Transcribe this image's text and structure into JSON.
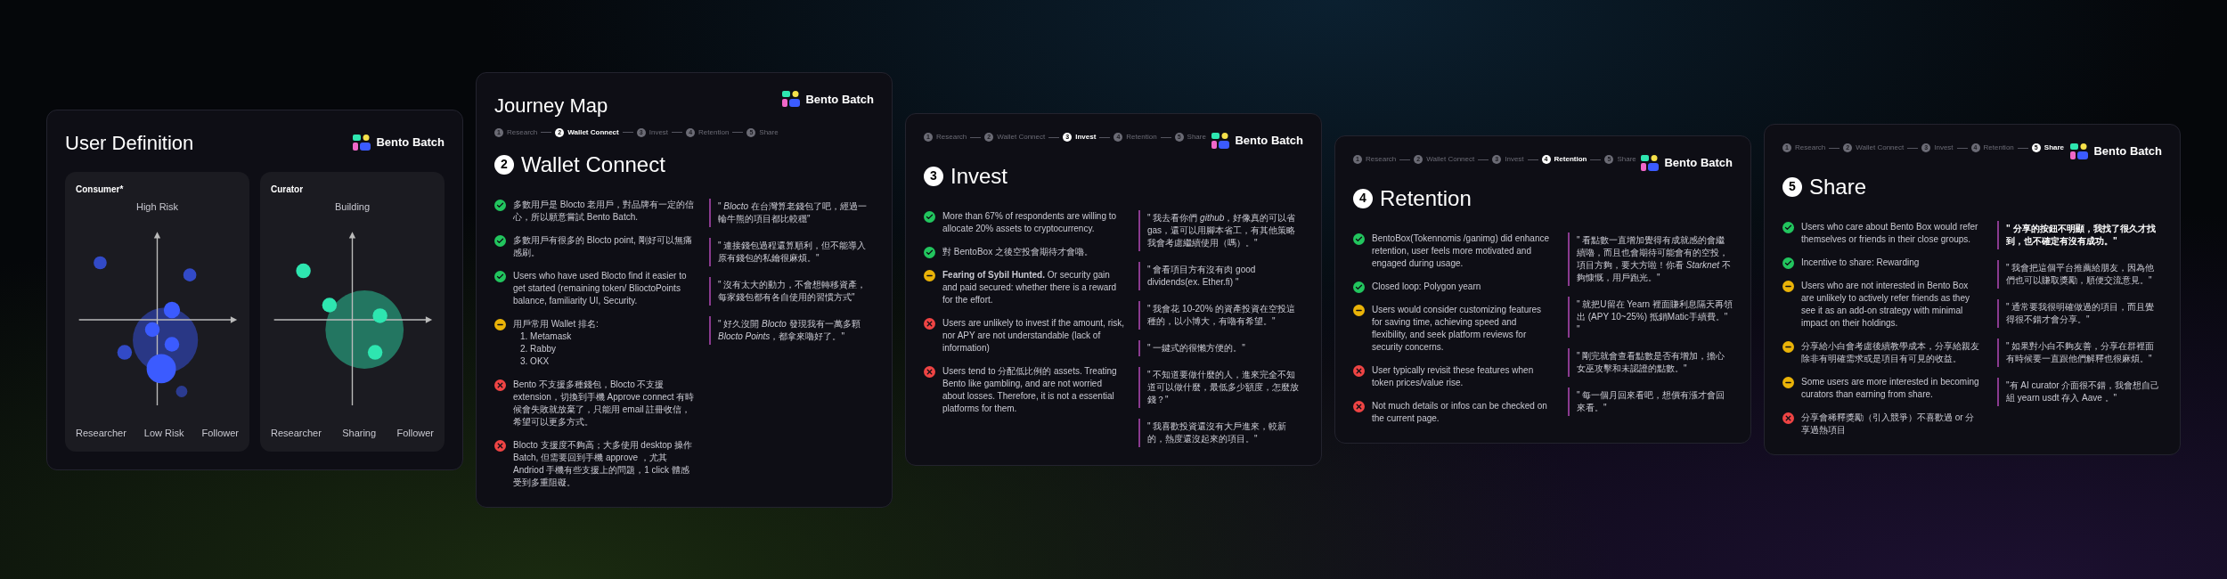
{
  "slides": [
    {
      "kind": "definition",
      "title": "User Definition",
      "logo": "Bento Batch",
      "maps": [
        {
          "label": "Consumer*",
          "color": "#3b5bff",
          "top": "High Risk",
          "bottom": "Low Risk",
          "left": "Researcher",
          "right": "Follower"
        },
        {
          "label": "Curator",
          "color": "#2ee6b0",
          "top": "Building",
          "bottom": "Sharing",
          "left": "Researcher",
          "right": "Follower"
        }
      ]
    },
    {
      "kind": "journey",
      "title": "Journey Map",
      "logo": "Bento Batch",
      "steps": [
        {
          "number": "1",
          "label": "Research",
          "selected": false
        },
        {
          "number": "2",
          "label": "Wallet Connect",
          "selected": true
        },
        {
          "number": "3",
          "label": "Invest",
          "selected": false
        },
        {
          "number": "4",
          "label": "Retention",
          "selected": false
        },
        {
          "number": "5",
          "label": "Share",
          "selected": false
        }
      ],
      "stage_number": "2",
      "stage": "Wallet Connect",
      "findings": [
        {
          "kind": "positive",
          "text": "多數用戶是 Blocto 老用戶，對品牌有一定的信心，所以願意嘗試 Bento Batch."
        },
        {
          "kind": "positive",
          "text": "多數用戶有很多的 Blocto point, 剛好可以無痛感刷。"
        },
        {
          "kind": "positive",
          "text": "Users who have used Blocto find it easier to get started (remaining token/ BlioctoPoints balance, familiarity UI, Security."
        },
        {
          "kind": "neutral",
          "text": "用戶常用 Wallet 排名:",
          "list": [
            "1. Metamask",
            "2. Rabby",
            "3. OKX"
          ]
        },
        {
          "kind": "negative",
          "text": "Bento 不支援多種錢包，Blocto 不支援 extension，切換到手機 Approve connect 有時候會失敗就放棄了，只能用 email 註冊收信，希望可以更多方式。"
        },
        {
          "kind": "negative",
          "text": "Blocto 支援度不夠高；大多使用 desktop 操作 Batch, 但需要回到手機 approve ，尤其 Andriod 手機有些支援上的問題，1 click 體感受到多重阻礙。"
        }
      ],
      "quotes": [
        {
          "text": "\" *Blocto* 在台灣算老錢包了吧，經過一輪牛熊的項目都比較穩\"",
          "emphasis": false
        },
        {
          "text": "\" 連接錢包過程還算順利，但不能導入原有錢包的私鑰很麻煩。\"",
          "emphasis": false
        },
        {
          "text": "\" 沒有太大的動力，不會想轉移資產，每家錢包都有各自使用的習慣方式\"",
          "emphasis": false
        },
        {
          "text": "\" 好久沒開 *Blocto* 發現我有一萬多顆 *Blocto Points*，都拿來嚕好了。\"",
          "emphasis": false
        }
      ]
    },
    {
      "kind": "journey",
      "logo": "Bento Batch",
      "steps": [
        {
          "number": "1",
          "label": "Research",
          "selected": false
        },
        {
          "number": "2",
          "label": "Wallet Connect",
          "selected": false
        },
        {
          "number": "3",
          "label": "Invest",
          "selected": true
        },
        {
          "number": "4",
          "label": "Retention",
          "selected": false
        },
        {
          "number": "5",
          "label": "Share",
          "selected": false
        }
      ],
      "stage_number": "3",
      "stage": "Invest",
      "findings": [
        {
          "kind": "positive",
          "text": "More than 67% of respondents are willing to allocate 20% assets to cryptocurrency."
        },
        {
          "kind": "positive",
          "text": "對 BentoBox 之後空投會期待才會嚕。"
        },
        {
          "kind": "neutral",
          "text": "**Fearing of Sybil Hunted.** Or security gain and paid secured: whether there is a reward for the effort."
        },
        {
          "kind": "negative",
          "text": "Users are unlikely to invest if the amount, risk, nor APY are not understandable (lack of information)"
        },
        {
          "kind": "negative",
          "text": "Users tend to 分配低比例的 assets. Treating Bento like gambling, and are not worried about losses. Therefore, it is not a essential platforms for them."
        }
      ],
      "quotes": [
        {
          "text": "\" 我去看你們 *github*，好像真的可以省 gas，還可以用腳本省工，有其他策略我會考慮繼續使用（嗎）。\"",
          "emphasis": false
        },
        {
          "text": "\" 會看項目方有沒有肉 good dividends(ex. Ether.fi) \"",
          "emphasis": false
        },
        {
          "text": "\" 我會花 10-20% 的資產投資在空投這種的，以小博大，有嚕有希望。\"",
          "emphasis": false
        },
        {
          "text": "\" 一鍵式的很懶方便的。\"",
          "emphasis": false
        },
        {
          "text": "\" 不知道要做什麼的人，進來完全不知道可以做什麼，最低多少額度，怎麼放錢？\"",
          "emphasis": false
        },
        {
          "text": "\" 我喜歡投資還沒有大戶進來，較新的，熱度還沒起來的項目。\"",
          "emphasis": false
        }
      ]
    },
    {
      "kind": "journey",
      "logo": "Bento Batch",
      "steps": [
        {
          "number": "1",
          "label": "Research",
          "selected": false
        },
        {
          "number": "2",
          "label": "Wallet Connect",
          "selected": false
        },
        {
          "number": "3",
          "label": "Invest",
          "selected": false
        },
        {
          "number": "4",
          "label": "Retention",
          "selected": true
        },
        {
          "number": "5",
          "label": "Share",
          "selected": false
        }
      ],
      "stage_number": "4",
      "stage": "Retention",
      "findings": [
        {
          "kind": "positive",
          "text": "BentoBox(Tokennomis /ganimg) did enhance retention, user feels more motivated and engaged during usage."
        },
        {
          "kind": "positive",
          "text": "Closed loop: Polygon yearn"
        },
        {
          "kind": "neutral",
          "text": "Users would consider customizing features for saving time, achieving speed and flexibility, and seek platform reviews for security concerns."
        },
        {
          "kind": "negative",
          "text": "User typically revisit these features when token prices/value rise."
        },
        {
          "kind": "negative",
          "text": "Not much details or infos can be checked on the current page."
        }
      ],
      "quotes": [
        {
          "text": "\" 看點數一直增加覺得有成就感的會繼續嚕，而且也會期待可能會有的空投，項目方夠，要大方啦！你看 *Starknet* 不夠慷慨，用戶跑光。\"",
          "emphasis": false
        },
        {
          "text": "\" 就把U留在 Yearn 裡面賺利息隔天再領出 (APY 10~25%) 抵銷Matic手續費。\" \"",
          "emphasis": false
        },
        {
          "text": "\" 剛完就會查看點數是否有增加，擔心女巫攻擊和未認證的點數。\"",
          "emphasis": false
        },
        {
          "text": "\" 每一個月回來看吧，想價有漲才會回來看。\"",
          "emphasis": false
        }
      ]
    },
    {
      "kind": "journey",
      "logo": "Bento Batch",
      "steps": [
        {
          "number": "1",
          "label": "Research",
          "selected": false
        },
        {
          "number": "2",
          "label": "Wallet Connect",
          "selected": false
        },
        {
          "number": "3",
          "label": "Invest",
          "selected": false
        },
        {
          "number": "4",
          "label": "Retention",
          "selected": false
        },
        {
          "number": "5",
          "label": "Share",
          "selected": true
        }
      ],
      "stage_number": "5",
      "stage": "Share",
      "findings": [
        {
          "kind": "positive",
          "text": "Users who care about Bento Box would refer themselves or friends in their close groups."
        },
        {
          "kind": "positive",
          "text": "Incentive to share: Rewarding"
        },
        {
          "kind": "neutral",
          "text": "Users who are not interested in Bento Box are unlikely to actively refer friends as they see it as an add-on strategy with minimal impact on their holdings."
        },
        {
          "kind": "neutral",
          "text": "分享給小白會考慮後續教學成本，分享給親友除非有明確需求或是項目有可見的收益。"
        },
        {
          "kind": "neutral",
          "text": "Some users are more interested in becoming curators than earning from share."
        },
        {
          "kind": "negative",
          "text": "分享會稀釋獎勵（引入競爭）不喜歡過 or 分享過熱項目"
        }
      ],
      "quotes": [
        {
          "text": "\" 分享的按鈕不明顯，我找了很久才找到，也不確定有沒有成功。\"",
          "emphasis": true
        },
        {
          "text": "\" 我會把這個平台推薦給朋友，因為他們也可以賺取獎勵，順便交流意見。\"",
          "emphasis": false
        },
        {
          "text": "\" 通常要我很明確做過的項目，而且覺得很不錯才會分享。\"",
          "emphasis": false
        },
        {
          "text": "\" 如果對小白不夠友善，分享在群裡面有時候要一直跟他們解釋也很麻煩。\"",
          "emphasis": false
        },
        {
          "text": "\"有 AI curator 介面很不錯，我會想自己組 yearn usdt 存入 Aave 。\"",
          "emphasis": false
        }
      ]
    }
  ]
}
